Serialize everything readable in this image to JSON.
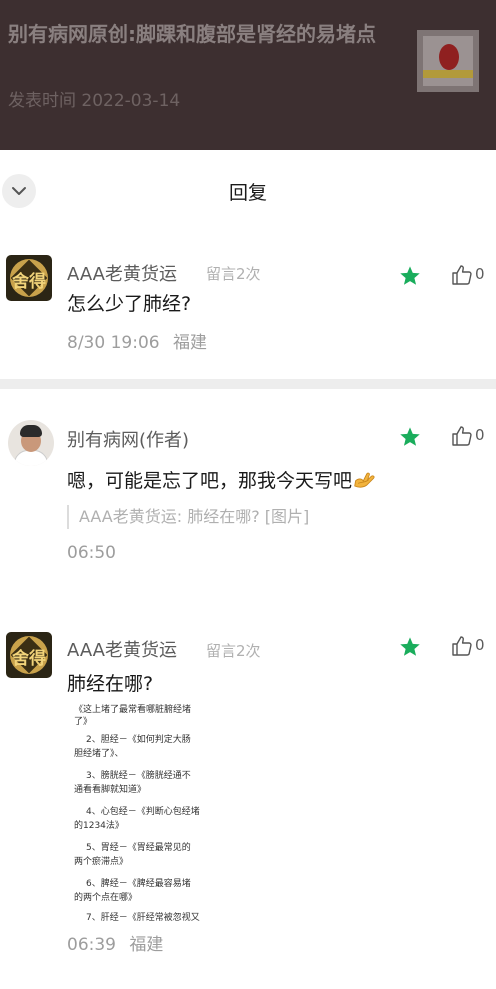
{
  "article": {
    "title": "别有病网原创:脚踝和腹部是肾经的易堵点",
    "date": "发表时间 2022-03-14"
  },
  "sheet": {
    "title": "回复"
  },
  "comments": [
    {
      "author": "AAA老黄货运",
      "tag": "留言2次",
      "text": "怎么少了肺经?",
      "time": "8/30 19:06",
      "location": "福建",
      "likes": "0"
    },
    {
      "author": "别有病网(作者)",
      "text": "嗯，可能是忘了吧，那我今天写吧",
      "quote": "AAA老黄货运: 肺经在哪? [图片]",
      "time": "06:50",
      "likes": "0"
    },
    {
      "author": "AAA老黄货运",
      "tag": "留言2次",
      "text": "肺经在哪?",
      "time": "06:39",
      "location": "福建",
      "likes": "0"
    }
  ],
  "avatar_glyph": "舍得",
  "image_lines": [
    "《这上堵了最常看哪脏腑经堵",
    "了》",
    "2、胆经－《如何判定大肠",
    "胆经堵了》、",
    "3、膀胱经－《膀胱经通不",
    "通看看脚就知道》",
    "4、心包经－《判断心包经堵",
    "的1234法》",
    "5、胃经－《胃经最常见的",
    "两个瘀滞点》",
    "6、脾经－《脾经最容易堵",
    "的两个点在哪》",
    "7、肝经－《肝经常被忽视又"
  ],
  "colors": {
    "star": "#1aad5c",
    "header_bg": "#3d2f30"
  }
}
